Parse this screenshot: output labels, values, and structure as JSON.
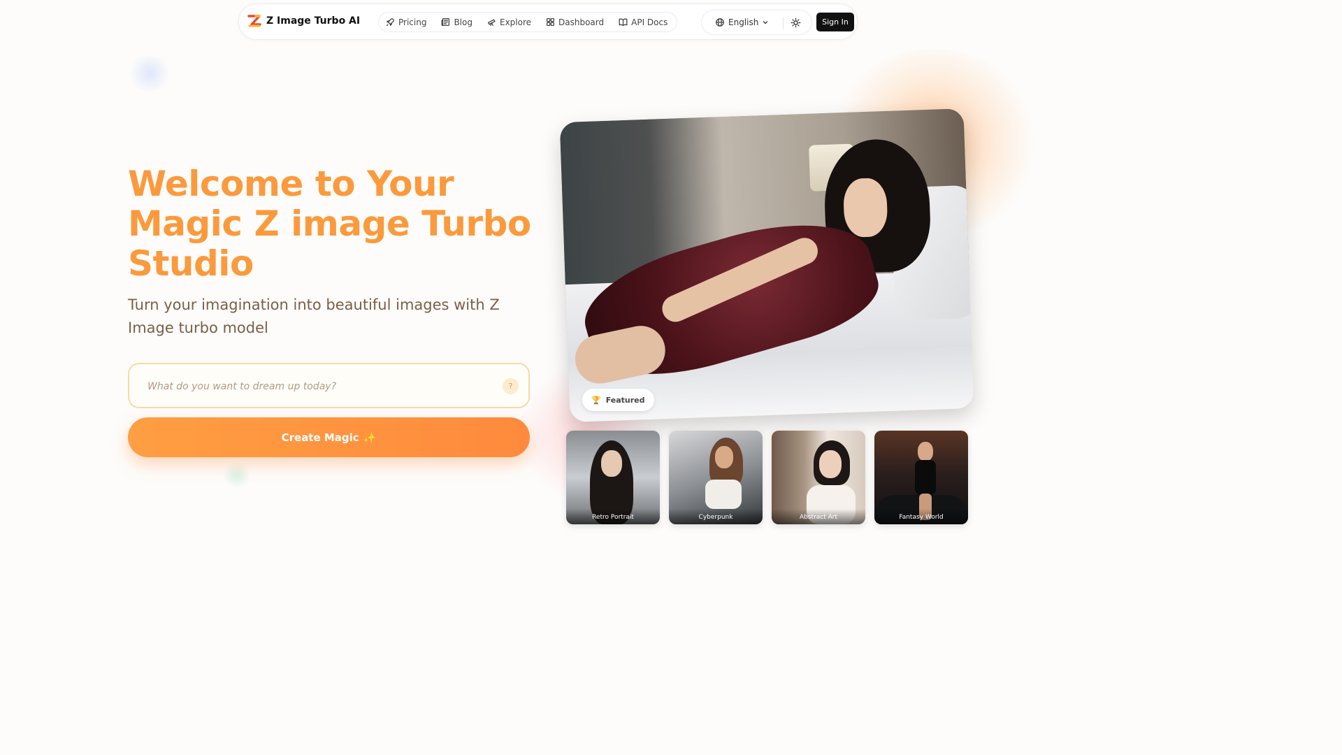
{
  "header": {
    "brand": "Z Image Turbo AI",
    "nav": [
      {
        "label": "Pricing",
        "icon": "rocket-icon"
      },
      {
        "label": "Blog",
        "icon": "newspaper-icon"
      },
      {
        "label": "Explore",
        "icon": "telescope-icon"
      },
      {
        "label": "Dashboard",
        "icon": "grid-icon"
      },
      {
        "label": "API Docs",
        "icon": "book-icon"
      }
    ],
    "language": "English",
    "sign_in": "Sign In"
  },
  "hero": {
    "title": "Welcome to Your Magic Z image Turbo Studio",
    "subtitle": "Turn your imagination into beautiful images with Z Image turbo model",
    "prompt_placeholder": "What do you want to dream up today?",
    "help": "?",
    "create_label": "Create Magic",
    "create_sparkle": "✨"
  },
  "feature": {
    "badge": "Featured",
    "badge_icon": "🏆"
  },
  "styles": [
    {
      "label": "Retro Portrait"
    },
    {
      "label": "Cyberpunk"
    },
    {
      "label": "Abstract Art"
    },
    {
      "label": "Fantasy World"
    }
  ],
  "colors": {
    "accent": "#fb9a3c",
    "button_gradient_start": "#ff9e42",
    "button_gradient_end": "#ff8a3d",
    "sign_in_bg": "#111111"
  }
}
